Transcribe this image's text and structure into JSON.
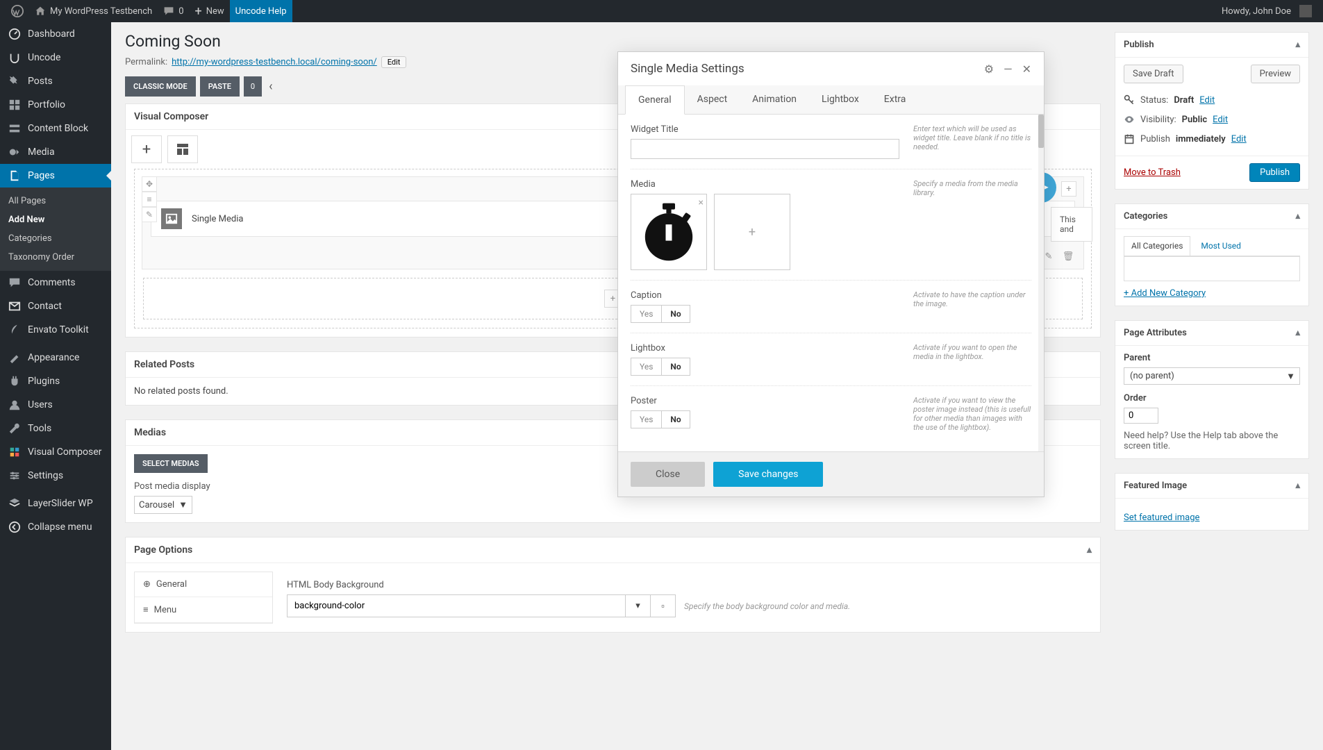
{
  "adminbar": {
    "site": "My WordPress Testbench",
    "comments": "0",
    "new": "New",
    "uncode_help": "Uncode Help",
    "howdy": "Howdy, John Doe"
  },
  "sidebar": {
    "items": [
      {
        "label": "Dashboard",
        "icon": "dashboard"
      },
      {
        "label": "Uncode",
        "icon": "uncode"
      },
      {
        "label": "Posts",
        "icon": "pin"
      },
      {
        "label": "Portfolio",
        "icon": "grid"
      },
      {
        "label": "Content Block",
        "icon": "blocks"
      },
      {
        "label": "Media",
        "icon": "media"
      },
      {
        "label": "Pages",
        "icon": "pages",
        "active": true
      },
      {
        "label": "Comments",
        "icon": "comment"
      },
      {
        "label": "Contact",
        "icon": "mail"
      },
      {
        "label": "Envato Toolkit",
        "icon": "envato"
      },
      {
        "label": "Appearance",
        "icon": "appearance"
      },
      {
        "label": "Plugins",
        "icon": "plugin"
      },
      {
        "label": "Users",
        "icon": "user"
      },
      {
        "label": "Tools",
        "icon": "tools"
      },
      {
        "label": "Visual Composer",
        "icon": "vc"
      },
      {
        "label": "Settings",
        "icon": "settings"
      },
      {
        "label": "LayerSlider WP",
        "icon": "layerslider"
      },
      {
        "label": "Collapse menu",
        "icon": "collapse"
      }
    ],
    "pages_sub": [
      "All Pages",
      "Add New",
      "Categories",
      "Taxonomy Order"
    ],
    "pages_sub_active": 1
  },
  "page": {
    "title": "Coming Soon",
    "permalink_label": "Permalink:",
    "permalink_url": "http://my-wordpress-testbench.local/coming-soon/",
    "edit": "Edit",
    "classic_mode": "CLASSIC MODE",
    "paste": "PASTE",
    "paste_count": "0"
  },
  "vc": {
    "panel_title": "Visual Composer",
    "element_label": "Single Media",
    "tip": "This and"
  },
  "related": {
    "title": "Related Posts",
    "empty": "No related posts found."
  },
  "medias": {
    "title": "Medias",
    "select_btn": "SELECT MEDIAS",
    "display_label": "Post media display",
    "display_value": "Carousel"
  },
  "page_options": {
    "title": "Page Options",
    "tab_general": "General",
    "tab_menu": "Menu",
    "bg_label": "HTML Body Background",
    "bg_value": "background-color",
    "bg_desc": "Specify the body background color and media."
  },
  "publish": {
    "title": "Publish",
    "save_draft": "Save Draft",
    "preview": "Preview",
    "status_label": "Status:",
    "status_value": "Draft",
    "visibility_label": "Visibility:",
    "visibility_value": "Public",
    "publish_label": "Publish",
    "publish_value": "immediately",
    "edit": "Edit",
    "trash": "Move to Trash",
    "submit": "Publish"
  },
  "categories": {
    "title": "Categories",
    "tab_all": "All Categories",
    "tab_most": "Most Used",
    "add": "+ Add New Category"
  },
  "attributes": {
    "title": "Page Attributes",
    "parent_label": "Parent",
    "parent_value": "(no parent)",
    "order_label": "Order",
    "order_value": "0",
    "help": "Need help? Use the Help tab above the screen title."
  },
  "featured": {
    "title": "Featured Image",
    "set": "Set featured image"
  },
  "modal": {
    "title": "Single Media Settings",
    "tabs": [
      "General",
      "Aspect",
      "Animation",
      "Lightbox",
      "Extra"
    ],
    "active_tab": 0,
    "widget_title_label": "Widget Title",
    "widget_title_desc": "Enter text which will be used as widget title. Leave blank if no title is needed.",
    "media_label": "Media",
    "media_desc": "Specify a media from the media library.",
    "caption_label": "Caption",
    "caption_desc": "Activate to have the caption under the image.",
    "lightbox_label": "Lightbox",
    "lightbox_desc": "Activate if you want to open the media in the lightbox.",
    "poster_label": "Poster",
    "poster_desc": "Activate if you want to view the poster image instead (this is usefull for other media than images with the use of the lightbox).",
    "yes": "Yes",
    "no": "No",
    "close": "Close",
    "save": "Save changes"
  }
}
